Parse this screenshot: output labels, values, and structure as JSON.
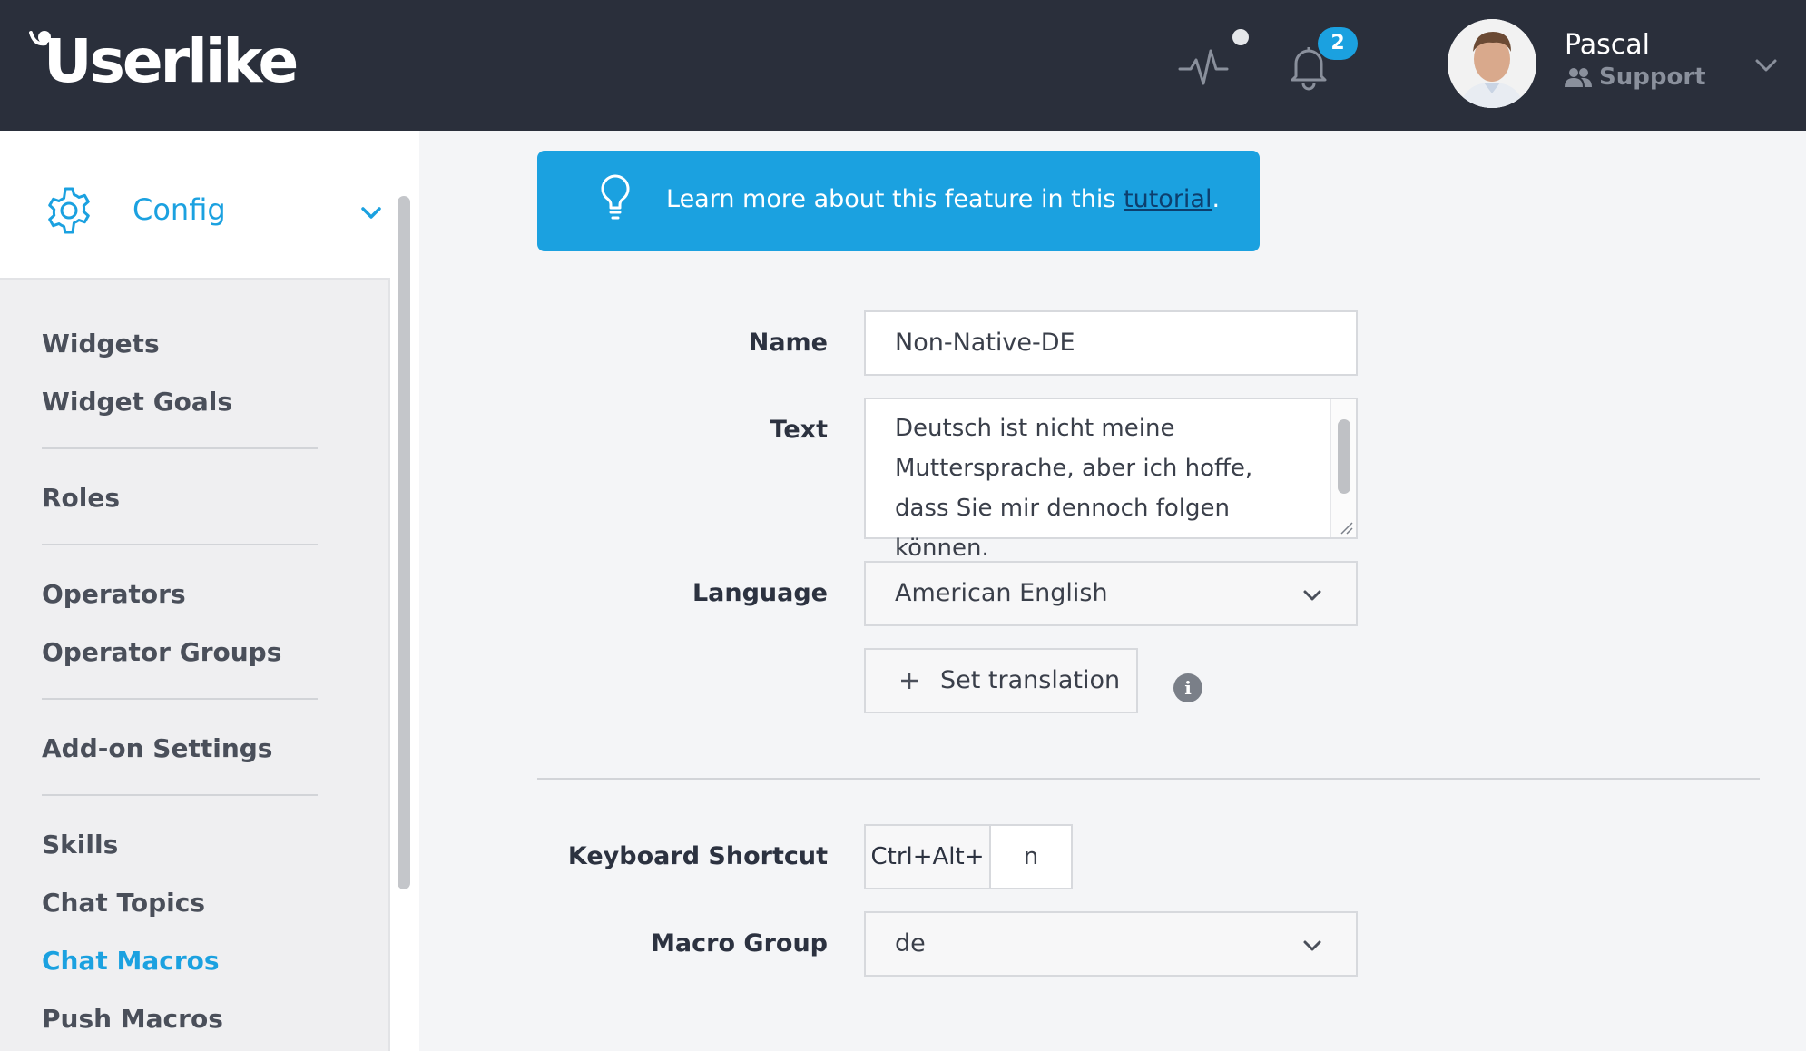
{
  "app": {
    "logo_text": "Userlike",
    "notifications_count": "2",
    "user": {
      "name": "Pascal",
      "role": "Support"
    }
  },
  "sidebar": {
    "section_title": "Config",
    "items": [
      {
        "label": "Widgets"
      },
      {
        "label": "Widget Goals"
      },
      {
        "label": "Roles"
      },
      {
        "label": "Operators"
      },
      {
        "label": "Operator Groups"
      },
      {
        "label": "Add-on Settings"
      },
      {
        "label": "Skills"
      },
      {
        "label": "Chat Topics"
      },
      {
        "label": "Chat Macros"
      },
      {
        "label": "Push Macros"
      }
    ],
    "active_item": "Chat Macros"
  },
  "banner": {
    "text_before": "Learn more about this feature in this ",
    "link_text": "tutorial",
    "text_after": "."
  },
  "form": {
    "name": {
      "label": "Name",
      "value": "Non-Native-DE"
    },
    "text": {
      "label": "Text",
      "value": "Deutsch ist nicht meine Muttersprache, aber ich hoffe,  dass Sie mir dennoch folgen können."
    },
    "language": {
      "label": "Language",
      "value": "American English"
    },
    "set_translation_label": "Set translation",
    "keyboard_shortcut": {
      "label": "Keyboard Shortcut",
      "prefix": "Ctrl+Alt+",
      "key": "n"
    },
    "macro_group": {
      "label": "Macro Group",
      "value": "de"
    }
  },
  "colors": {
    "topbar": "#2a2f3b",
    "accent": "#1ba1e0",
    "sidebar_bg": "#efeff1",
    "page_bg": "#f4f5f7"
  },
  "icons": [
    "activity-icon",
    "bell-icon",
    "chevron-down-icon",
    "gear-icon",
    "lightbulb-icon",
    "plus-icon",
    "info-icon",
    "users-icon"
  ]
}
